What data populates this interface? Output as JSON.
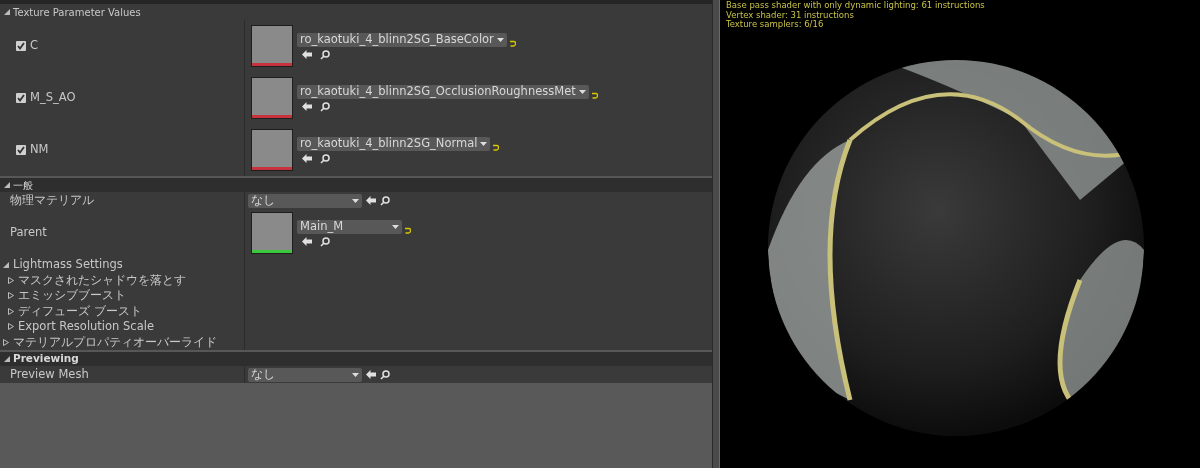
{
  "details_panel": {
    "sections": [
      {
        "kind": "subheader",
        "title": "Texture Parameter Values",
        "expanded": true,
        "rows": [
          {
            "kind": "texture",
            "label": "C",
            "checked": true,
            "asset": "ro_kaotuki_4_blinn2SG_BaseColor",
            "color": "#c8323c",
            "reset_to_default": true
          },
          {
            "kind": "texture",
            "label": "M_S_AO",
            "checked": true,
            "asset": "ro_kaotuki_4_blinn2SG_OcclusionRoughnessMet",
            "color": "#c8323c",
            "reset_to_default": true
          },
          {
            "kind": "texture",
            "label": "NM",
            "checked": true,
            "asset": "ro_kaotuki_4_blinn2SG_Normal",
            "color": "#c8323c",
            "reset_to_default": true
          }
        ]
      },
      {
        "kind": "category",
        "title": "一般",
        "expanded": true,
        "rows": [
          {
            "kind": "asset",
            "label": "物理マテリアル",
            "asset": "なし",
            "reset_to_default": false
          },
          {
            "kind": "asset_thumb",
            "label": "Parent",
            "asset": "Main_M",
            "color": "#3cc83c",
            "reset_to_default": true
          },
          {
            "kind": "group",
            "label": "Lightmass Settings",
            "expanded": true,
            "children": [
              {
                "label": "マスクされたシャドウを落とす",
                "expanded": false
              },
              {
                "label": "エミッシブブースト",
                "expanded": false
              },
              {
                "label": "ディフューズ ブースト",
                "expanded": false
              },
              {
                "label": "Export Resolution Scale",
                "expanded": false
              }
            ]
          },
          {
            "kind": "group",
            "label": "マテリアルプロパティオーバーライド",
            "expanded": false,
            "children": []
          }
        ]
      },
      {
        "kind": "category",
        "title": "Previewing",
        "expanded": true,
        "rows": [
          {
            "kind": "asset",
            "label": "Preview Mesh",
            "asset": "なし",
            "reset_to_default": false
          }
        ]
      }
    ]
  },
  "viewport": {
    "stats": [
      "Base pass shader with only dynamic lighting: 61 instructions",
      "Vertex shader: 31 instructions",
      "Texture samplers: 6/16"
    ]
  }
}
